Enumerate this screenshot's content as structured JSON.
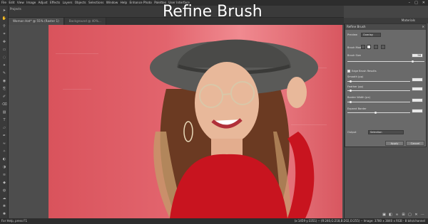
{
  "window": {
    "menu_items": [
      "File",
      "Edit",
      "View",
      "Image",
      "Adjust",
      "Effects",
      "Layers",
      "Objects",
      "Selections",
      "Window",
      "Help",
      "Enhance Photo",
      "Palettes",
      "User Interface"
    ],
    "controls": [
      "–",
      "□",
      "✕"
    ]
  },
  "overlay_title": "Refine Brush",
  "projects": {
    "label": "Projects"
  },
  "tabs": [
    {
      "label": "Woman Hat* @ 55% (Raster 1)"
    },
    {
      "label": "Background @ 40%..."
    }
  ],
  "right_panel": {
    "materials_label": "Materials"
  },
  "dialog": {
    "title": "Refine Brush",
    "close": "✕",
    "preview_label": "Preview",
    "preview_value": "Overlay",
    "brush_mode_label": "Brush Mode",
    "brush_size_label": "Brush Size",
    "brush_size_value": "56",
    "brush_size_level": 0.85,
    "edge_label": "Edge Brush Results",
    "smooth_label": "Smooth (pp)",
    "smooth_value": "",
    "smooth_level": 0.05,
    "feather_label": "Feather (pp)",
    "feather_value": "",
    "feather_level": 0.05,
    "border_width_label": "Border Width (px)",
    "border_width_value": "",
    "border_width_level": 0.05,
    "expand_label": "Expand Border",
    "expand_value": "",
    "expand_level": 0.45,
    "output_label": "Output",
    "output_value": "Selection",
    "apply_label": "Apply",
    "cancel_label": "Cancel"
  },
  "statusbar": {
    "left": "For Help, press F1",
    "right": "(x:1459 y:3351) -- (R:240,G:218,B:202,O:255) -- Image: 3780 x 3840 x RGB - 8 bits/channel"
  },
  "icons": {
    "tools": [
      "pointer-icon",
      "pan-icon",
      "zoom-icon",
      "crop-icon",
      "move-icon",
      "selection-icon",
      "lasso-icon",
      "wand-icon",
      "eyedropper-icon",
      "red-eye-icon",
      "clone-icon",
      "brush-icon",
      "eraser-icon",
      "fill-icon",
      "text-icon",
      "shape-icon",
      "pen-icon",
      "warp-icon",
      "retouch-icon",
      "dodge-icon",
      "burn-icon",
      "smudge-icon",
      "sharpen-icon",
      "blur-icon",
      "sponge-icon",
      "picture-tube-icon",
      "airbrush-icon",
      "lighten-icon"
    ]
  }
}
